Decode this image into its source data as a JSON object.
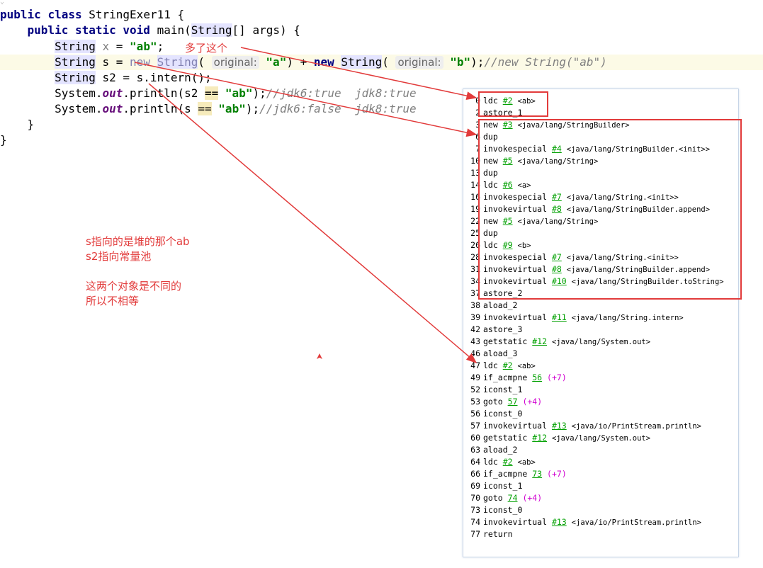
{
  "code": {
    "lines": [
      {
        "kind": "plain",
        "text": "public class StringExer11 {"
      },
      {
        "kind": "plain",
        "text": "    public static void main(String[] args) {"
      },
      {
        "kind": "plain",
        "text": "        String x = \"ab\";"
      },
      {
        "kind": "plain",
        "text": "        String s = new String( original: \"a\") + new String( original: \"b\");//new String(\"ab\")"
      },
      {
        "kind": "plain",
        "text": "        String s2 = s.intern();"
      },
      {
        "kind": "plain",
        "text": "        System.out.println(s2 == \"ab\");//jdk6:true  jdk8:true"
      },
      {
        "kind": "plain",
        "text": "        System.out.println(s == \"ab\");//jdk6:false  jdk8:true"
      },
      {
        "kind": "plain",
        "text": "    }"
      },
      {
        "kind": "plain",
        "text": "}"
      }
    ],
    "tokens": {
      "public": "public",
      "class": "class",
      "static": "static",
      "void": "void",
      "new": "new",
      "StringExer11": "StringExer11",
      "main": "main(",
      "String": "String",
      "args": "[] args) {",
      "x": "x",
      "eq": " = ",
      "ab": "\"ab\"",
      "semi": ";",
      "s": "s",
      "hint": "original:",
      "a": "\"a\"",
      "b": "\"b\"",
      "plus": ") + ",
      "close_paren": ");",
      "close_paren1": ")",
      "cmt_new": "//new String(\"ab\")",
      "s2": "s2",
      "intern": " = s.intern();",
      "system": "System.",
      "out": "out",
      "println_open": ".println(",
      "eqeq": "==",
      "cmt1": "//jdk6:true  jdk8:true",
      "cmt2": "//jdk6:false  jdk8:true",
      "brace_close": "}",
      "brace_open": " {",
      "sp": " ",
      "lparen": "( "
    }
  },
  "annotations": {
    "extra_note": "多了这个",
    "explain": "s指向的是堆的那个ab\ns2指向常量池\n\n这两个对象是不同的\n所以不相等"
  },
  "bytecode": [
    {
      "off": "0",
      "op": "ldc",
      "ref": "#2",
      "arg": "<ab>"
    },
    {
      "off": "2",
      "op": "astore_1"
    },
    {
      "off": "3",
      "op": "new",
      "ref": "#3",
      "arg": "<java/lang/StringBuilder>"
    },
    {
      "off": "6",
      "op": "dup"
    },
    {
      "off": "7",
      "op": "invokespecial",
      "ref": "#4",
      "arg": "<java/lang/StringBuilder.<init>>"
    },
    {
      "off": "10",
      "op": "new",
      "ref": "#5",
      "arg": "<java/lang/String>"
    },
    {
      "off": "13",
      "op": "dup"
    },
    {
      "off": "14",
      "op": "ldc",
      "ref": "#6",
      "arg": "<a>"
    },
    {
      "off": "16",
      "op": "invokespecial",
      "ref": "#7",
      "arg": "<java/lang/String.<init>>"
    },
    {
      "off": "19",
      "op": "invokevirtual",
      "ref": "#8",
      "arg": "<java/lang/StringBuilder.append>"
    },
    {
      "off": "22",
      "op": "new",
      "ref": "#5",
      "arg": "<java/lang/String>"
    },
    {
      "off": "25",
      "op": "dup"
    },
    {
      "off": "26",
      "op": "ldc",
      "ref": "#9",
      "arg": "<b>"
    },
    {
      "off": "28",
      "op": "invokespecial",
      "ref": "#7",
      "arg": "<java/lang/String.<init>>"
    },
    {
      "off": "31",
      "op": "invokevirtual",
      "ref": "#8",
      "arg": "<java/lang/StringBuilder.append>"
    },
    {
      "off": "34",
      "op": "invokevirtual",
      "ref": "#10",
      "arg": "<java/lang/StringBuilder.toString>"
    },
    {
      "off": "37",
      "op": "astore_2"
    },
    {
      "off": "38",
      "op": "aload_2"
    },
    {
      "off": "39",
      "op": "invokevirtual",
      "ref": "#11",
      "arg": "<java/lang/String.intern>"
    },
    {
      "off": "42",
      "op": "astore_3"
    },
    {
      "off": "43",
      "op": "getstatic",
      "ref": "#12",
      "arg": "<java/lang/System.out>"
    },
    {
      "off": "46",
      "op": "aload_3"
    },
    {
      "off": "47",
      "op": "ldc",
      "ref": "#2",
      "arg": "<ab>"
    },
    {
      "off": "49",
      "op": "if_acmpne",
      "ref": "56",
      "rel": "(+7)"
    },
    {
      "off": "52",
      "op": "iconst_1"
    },
    {
      "off": "53",
      "op": "goto",
      "ref": "57",
      "rel": "(+4)"
    },
    {
      "off": "56",
      "op": "iconst_0"
    },
    {
      "off": "57",
      "op": "invokevirtual",
      "ref": "#13",
      "arg": "<java/io/PrintStream.println>"
    },
    {
      "off": "60",
      "op": "getstatic",
      "ref": "#12",
      "arg": "<java/lang/System.out>"
    },
    {
      "off": "63",
      "op": "aload_2"
    },
    {
      "off": "64",
      "op": "ldc",
      "ref": "#2",
      "arg": "<ab>"
    },
    {
      "off": "66",
      "op": "if_acmpne",
      "ref": "73",
      "rel": "(+7)"
    },
    {
      "off": "69",
      "op": "iconst_1"
    },
    {
      "off": "70",
      "op": "goto",
      "ref": "74",
      "rel": "(+4)"
    },
    {
      "off": "73",
      "op": "iconst_0"
    },
    {
      "off": "74",
      "op": "invokevirtual",
      "ref": "#13",
      "arg": "<java/io/PrintStream.println>"
    },
    {
      "off": "77",
      "op": "return"
    }
  ],
  "colors": {
    "annotation": "#e23b3b",
    "keyword": "#000080",
    "string": "#008000",
    "ref": "#00a000",
    "relative": "#d000d0"
  }
}
